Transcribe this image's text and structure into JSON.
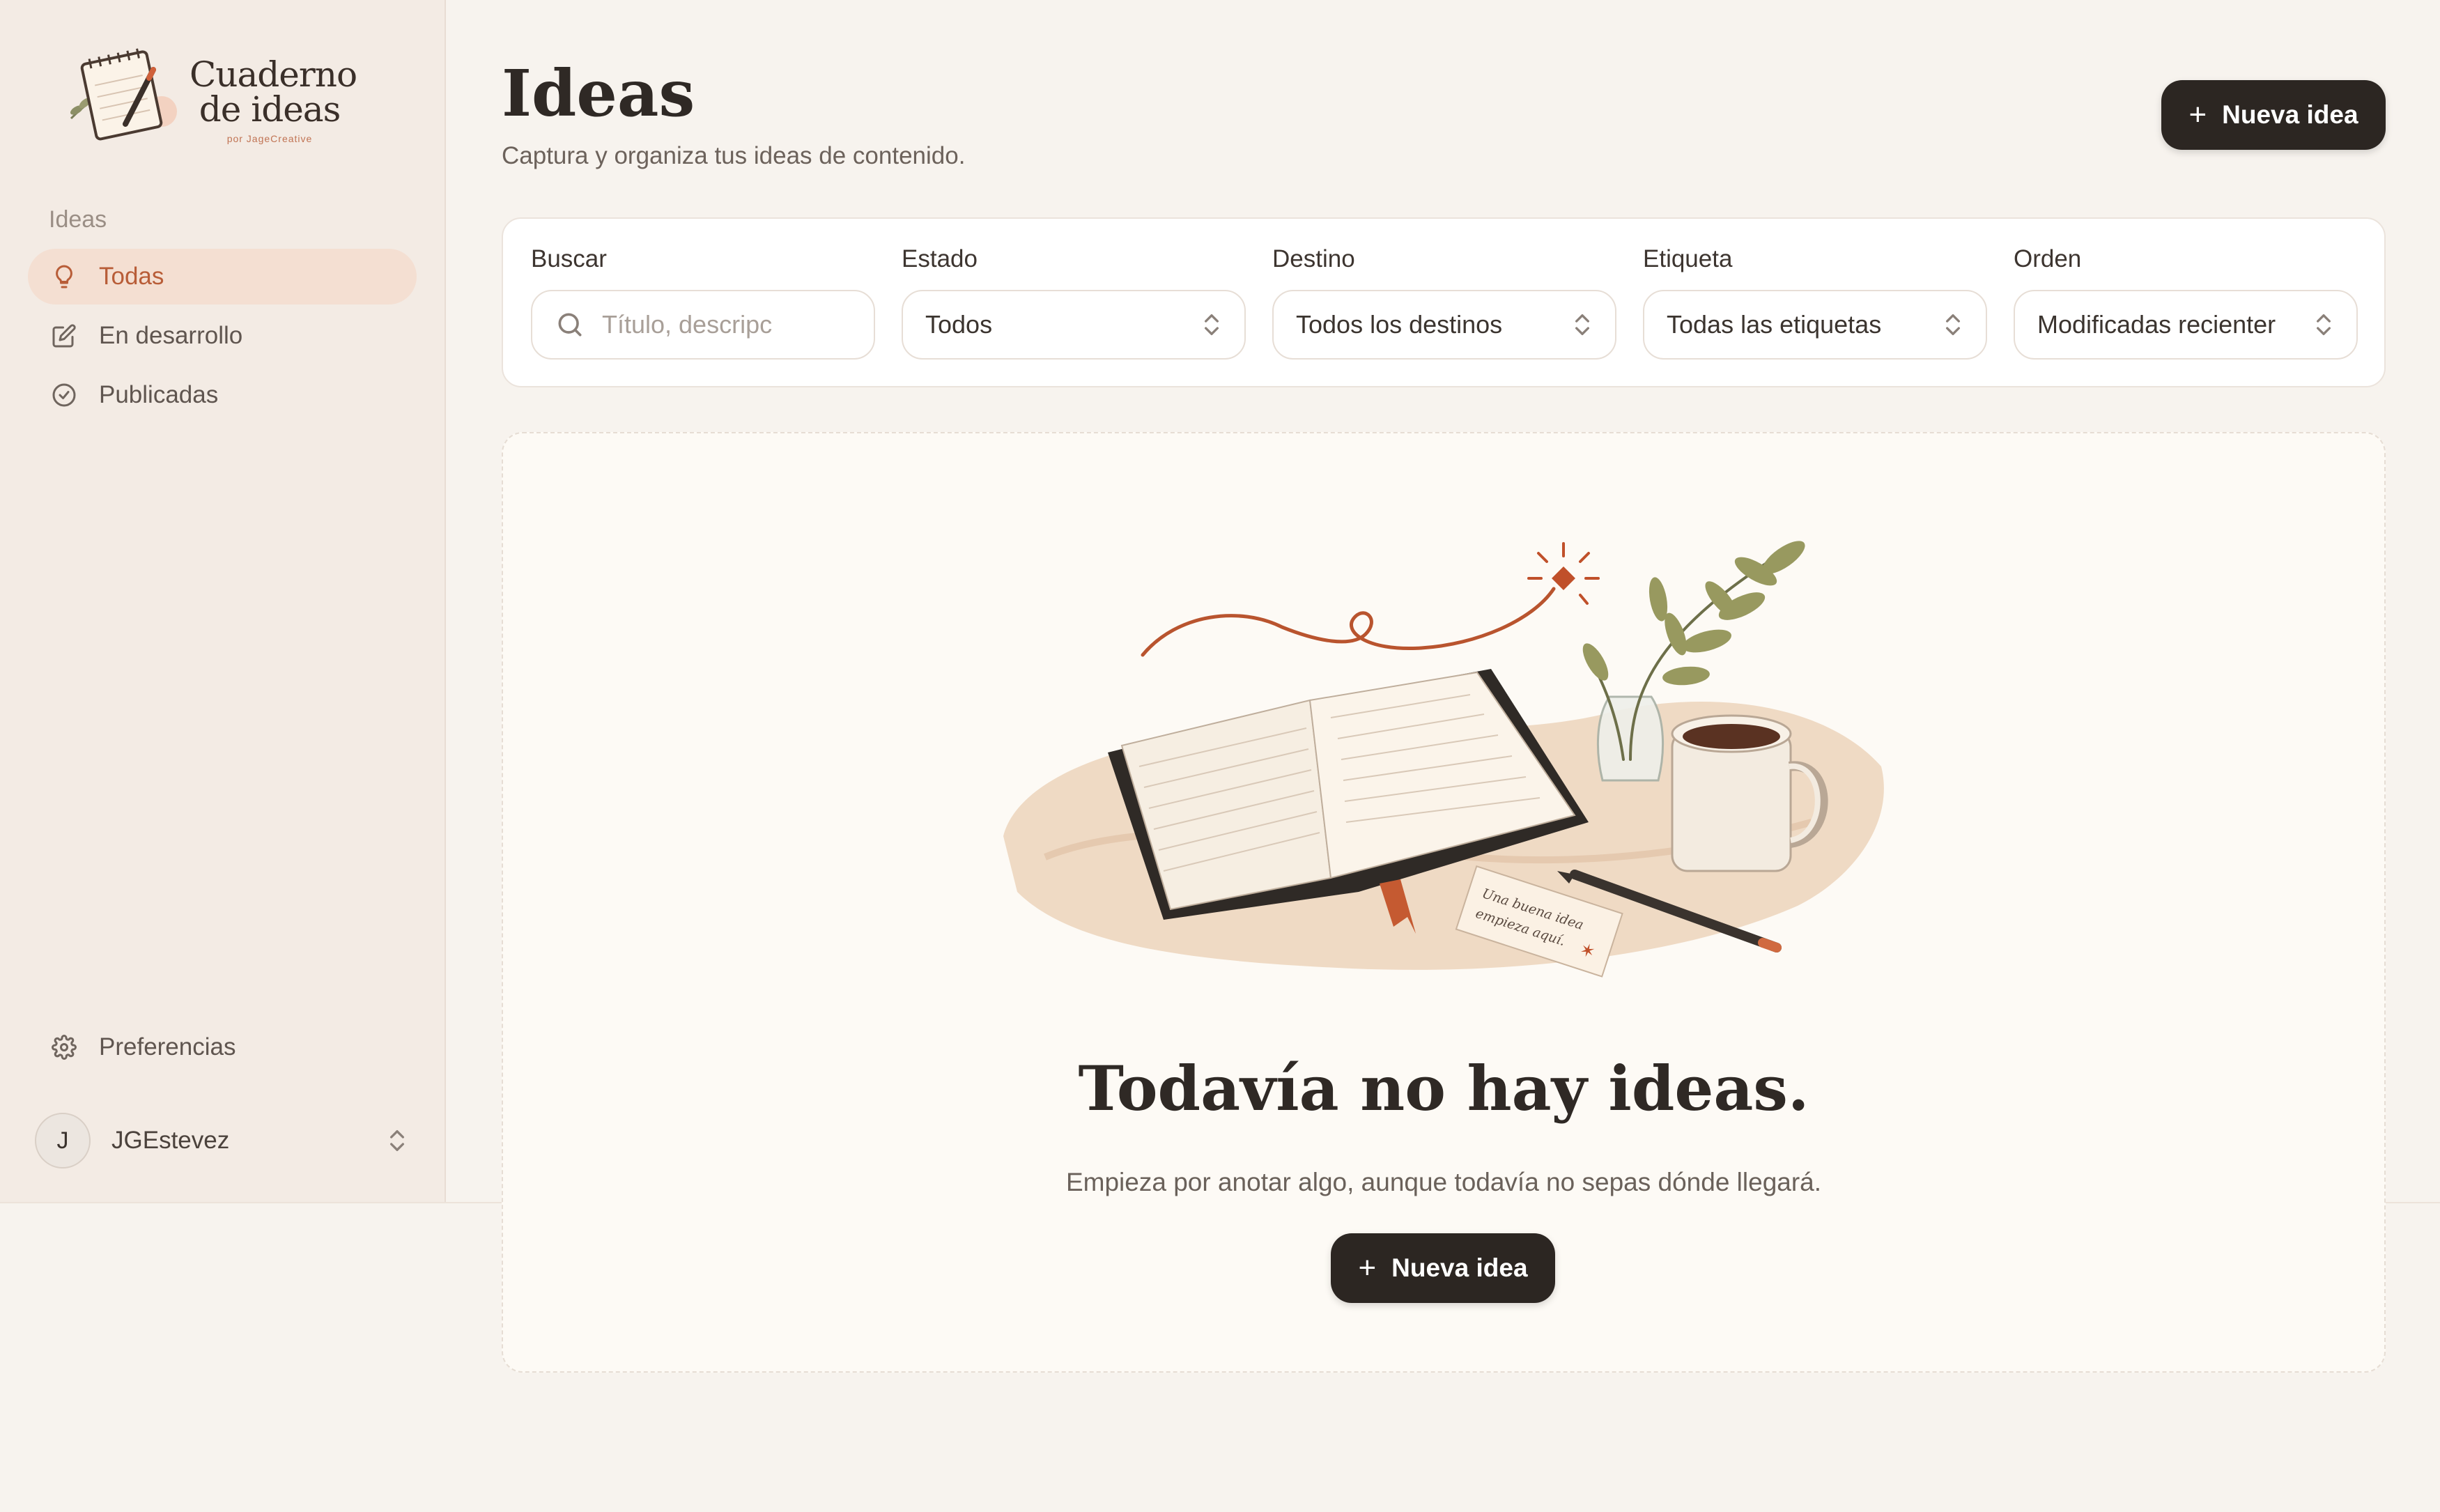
{
  "app": {
    "logo_line1": "Cuaderno",
    "logo_line2": "de ideas",
    "logo_byline": "por JageCreative"
  },
  "sidebar": {
    "section_label": "Ideas",
    "items": [
      {
        "label": "Todas",
        "icon": "lightbulb-icon",
        "active": true
      },
      {
        "label": "En desarrollo",
        "icon": "edit-icon",
        "active": false
      },
      {
        "label": "Publicadas",
        "icon": "check-circle-icon",
        "active": false
      }
    ],
    "preferences_label": "Preferencias",
    "user": {
      "initial": "J",
      "name": "JGEstevez"
    }
  },
  "header": {
    "title": "Ideas",
    "subtitle": "Captura y organiza tus ideas de contenido.",
    "new_idea_label": "Nueva idea"
  },
  "filters": {
    "search": {
      "label": "Buscar",
      "placeholder": "Título, descripc",
      "value": ""
    },
    "status": {
      "label": "Estado",
      "value": "Todos"
    },
    "destination": {
      "label": "Destino",
      "value": "Todos los destinos"
    },
    "tag": {
      "label": "Etiqueta",
      "value": "Todas las etiquetas"
    },
    "order": {
      "label": "Orden",
      "value": "Modificadas recienter"
    }
  },
  "empty_state": {
    "title": "Todavía no hay ideas.",
    "message": "Empieza por anotar algo, aunque todavía no sepas dónde llegará.",
    "button_label": "Nueva idea",
    "note_text_line1": "Una buena idea",
    "note_text_line2": "empieza aquí."
  },
  "colors": {
    "accent": "#b85d38",
    "dark_button": "#2c2622",
    "background": "#f7f3ee",
    "sidebar_bg": "#f3ebe4"
  }
}
